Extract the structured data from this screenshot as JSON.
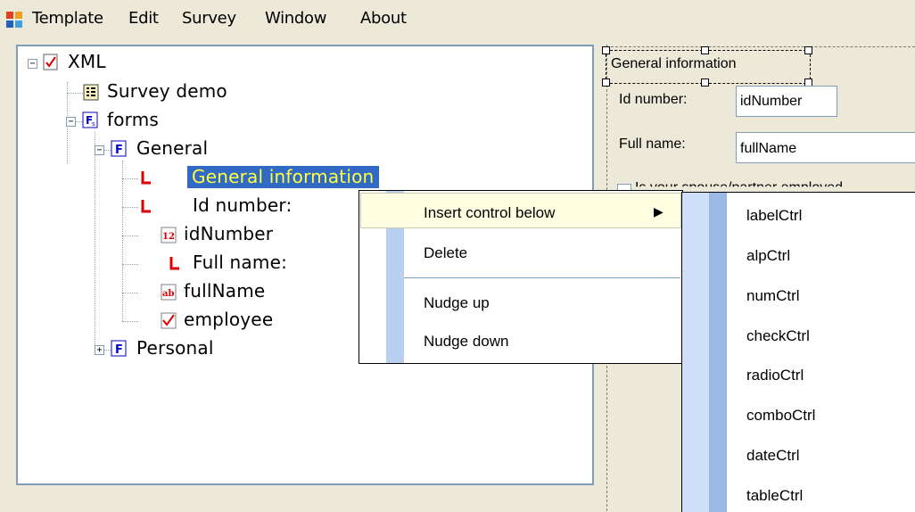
{
  "menubar": {
    "items": [
      "Template",
      "Edit",
      "Survey",
      "Window",
      "About"
    ]
  },
  "tree": {
    "root": "XML",
    "survey": "Survey demo",
    "forms": "forms",
    "general": "General",
    "general_information": "General information",
    "id_number_label": "Id number:",
    "id_number": "idNumber",
    "full_name_label": "Full name:",
    "full_name": "fullName",
    "employee": "employee",
    "personal": "Personal"
  },
  "designer": {
    "group_label": "General information",
    "id_label": "Id number:",
    "id_value": "idNumber",
    "name_label": "Full name:",
    "name_value": "fullName",
    "check_text": "Is your spouse/partner employed"
  },
  "context_menu": {
    "items": [
      "Insert control below",
      "Delete",
      "Nudge up",
      "Nudge down"
    ],
    "submenu_arrow": "▶"
  },
  "submenu": {
    "items": [
      "labelCtrl",
      "alpCtrl",
      "numCtrl",
      "checkCtrl",
      "radioCtrl",
      "comboCtrl",
      "dateCtrl",
      "tableCtrl"
    ]
  },
  "colors": {
    "selection": "#316ac5",
    "selection_text": "#ffff40",
    "icon_red": "#e00000",
    "icon_blue": "#0000c0"
  }
}
